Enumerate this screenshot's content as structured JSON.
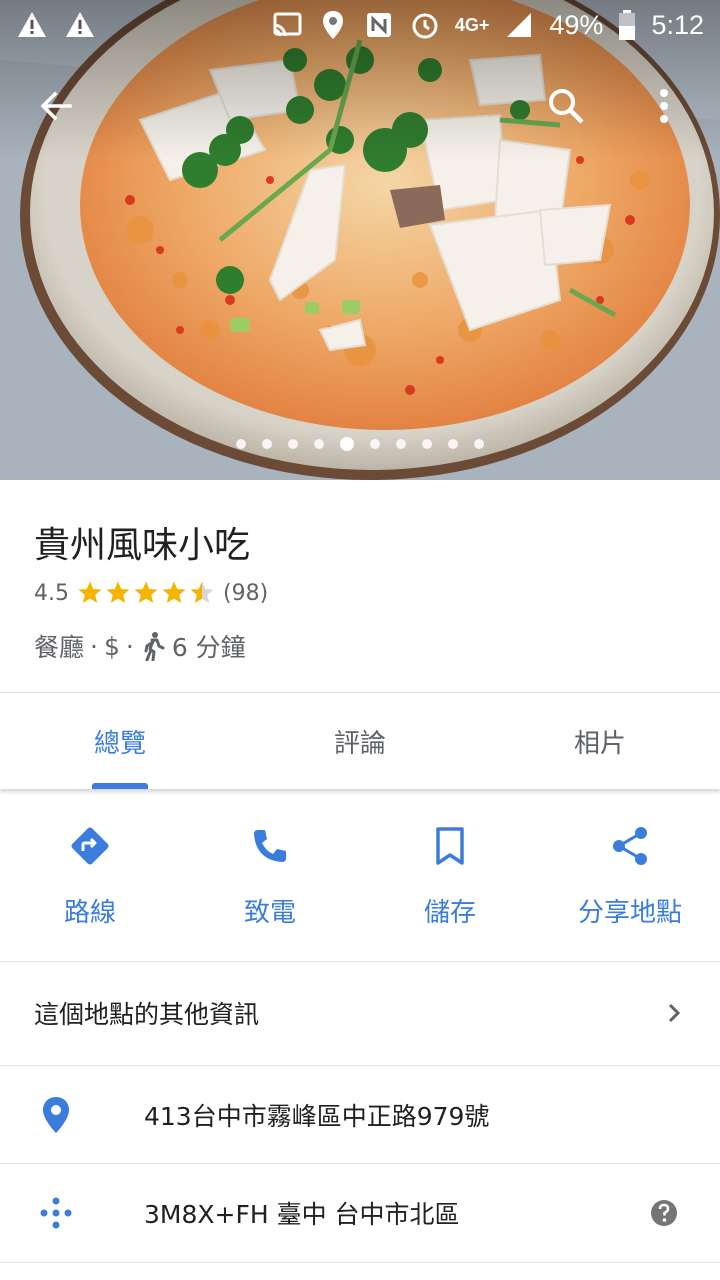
{
  "status_bar": {
    "battery": "49%",
    "time": "5:12",
    "network": "4G+",
    "icons": [
      "warning-icon",
      "warning-icon",
      "cast-icon",
      "location-icon",
      "nfc-icon",
      "alarm-icon",
      "signal-icon",
      "battery-icon"
    ]
  },
  "photo": {
    "page_count": 10,
    "active_page": 5
  },
  "place": {
    "title": "貴州風味小吃",
    "rating": "4.5",
    "rating_value": 4.5,
    "review_count": "(98)",
    "category": "餐廳",
    "price": "$",
    "separator": "·",
    "walk_time": "6 分鐘"
  },
  "tabs": [
    {
      "label": "總覽",
      "active": true
    },
    {
      "label": "評論",
      "active": false
    },
    {
      "label": "相片",
      "active": false
    }
  ],
  "actions": [
    {
      "label": "路線",
      "icon": "directions-icon"
    },
    {
      "label": "致電",
      "icon": "phone-icon"
    },
    {
      "label": "儲存",
      "icon": "bookmark-icon"
    },
    {
      "label": "分享地點",
      "icon": "share-icon"
    }
  ],
  "more_info": {
    "label": "這個地點的其他資訊"
  },
  "address": {
    "text": "413台中市霧峰區中正路979號"
  },
  "plus_code": {
    "text": "3M8X+FH 臺中 台中市北區"
  },
  "colors": {
    "accent": "#3b7ddd",
    "star": "#f4b400",
    "secondary_text": "#5f6368"
  }
}
